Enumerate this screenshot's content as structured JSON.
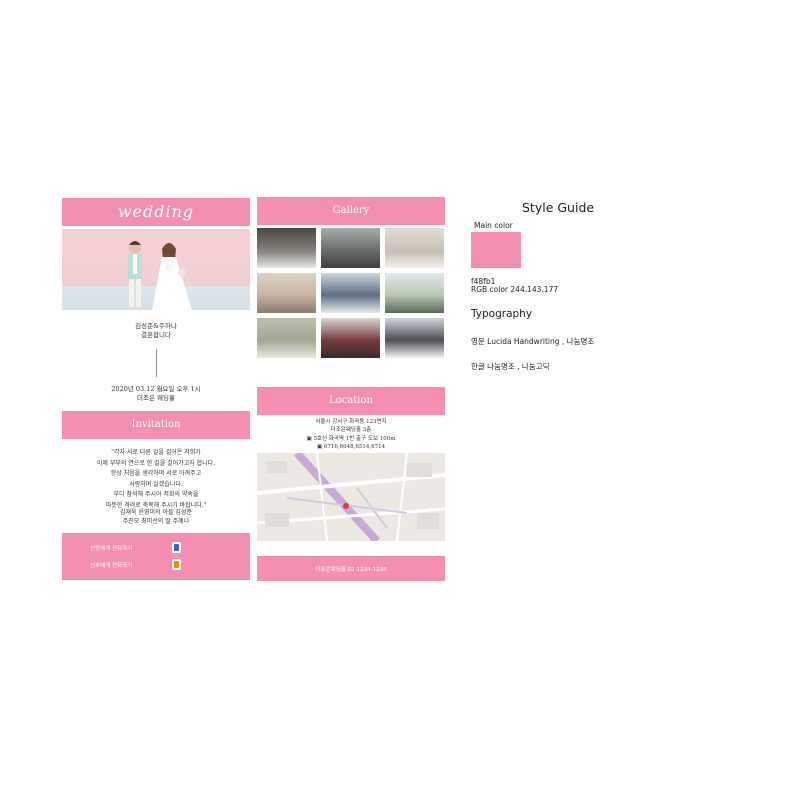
{
  "colors": {
    "main": "#f48fb1",
    "white": "#ffffff"
  },
  "column1": {
    "header_title": "wedding",
    "couple_names": "김성준&주하나",
    "subtitle": "결혼합니다",
    "date": "2020년 03.12 월요일 오후 1시",
    "venue": "더조은 웨딩홀",
    "invitation_title": "Invitation",
    "invitation_lines": [
      "\"각자 서로 다른 길을 걸어온 저희가",
      "이제 부부의 연으로 한 길을 걸어가고자 합니다.",
      "항상 처음을 생각하며 서로 아껴주고",
      "사랑하며 살겠습니다.",
      "부디 참석해 주시어 저희의 약속을",
      "따뜻한 격려로 축복해 주시기 바랍니다.\""
    ],
    "parents_line1": "김재욱 윤영미의 아들 김성준",
    "parents_line2": "주진모 최미선의 딸 주혜나",
    "call_groom": "신랑에게 전화하기",
    "call_bride": "신부에게 전화하기"
  },
  "column2": {
    "gallery_title": "Gallery",
    "location_title": "Location",
    "address": "서울시 강서구 화곡동 123번지",
    "hall": "더조은웨딩홀 3층",
    "subway": "5호선 화곡역 1번 출구 도보 100m",
    "bus": "6716,6648,6514,6714",
    "footer": "더조은웨딩홀 02-1234-1234"
  },
  "style_guide": {
    "title": "Style Guide",
    "main_color_label": "Main color",
    "hex": "f48fb1",
    "rgb": "RGB color  244.143.177",
    "typography_title": "Typography",
    "english_fonts": "영문  Lucida Handwriting , 나눔명조",
    "korean_fonts": "한글 나눔명조 , 나눔고딕"
  }
}
